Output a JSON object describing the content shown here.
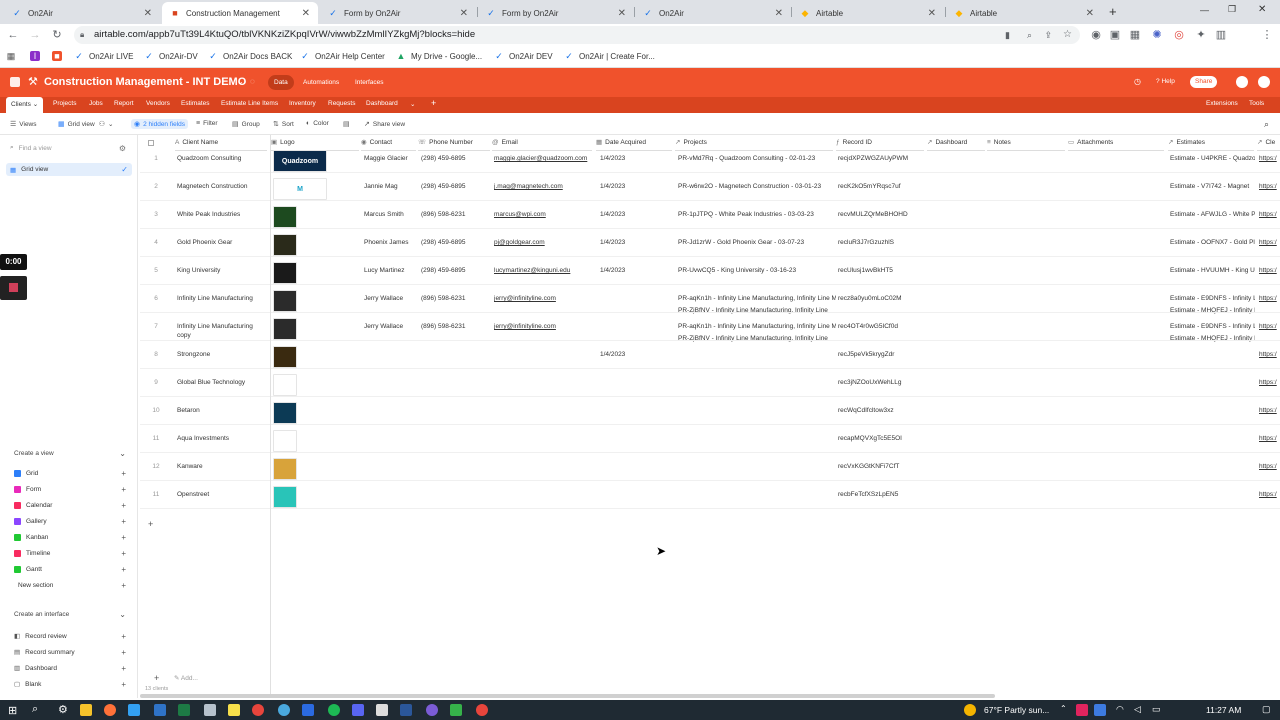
{
  "browser": {
    "tabs": [
      {
        "label": "On2Air",
        "icon": "on2air-icon",
        "active": false
      },
      {
        "label": "Construction Management",
        "icon": "airtable-icon",
        "active": true
      },
      {
        "label": "Form by On2Air",
        "icon": "on2air-icon",
        "active": false
      },
      {
        "label": "Form by On2Air",
        "icon": "on2air-icon",
        "active": false
      },
      {
        "label": "On2Air",
        "icon": "on2air-icon",
        "active": false
      },
      {
        "label": "Airtable",
        "icon": "airtable-icon",
        "active": false
      },
      {
        "label": "Airtable",
        "icon": "airtable-icon",
        "active": false
      }
    ],
    "url": "airtable.com/appb7uTt39L4KtuQO/tblVKNKziZKpqIVrW/viwwbZzMmlIYZkgMj?blocks=hide",
    "bookmarks": [
      "On2Air LIVE",
      "On2Air-DV",
      "On2Air Docs BACK",
      "On2Air Help Center",
      "My Drive - Google...",
      "On2Air DEV",
      "On2Air | Create For..."
    ],
    "profile_initial": "O"
  },
  "app": {
    "base_title": "Construction Management - INT DEMO",
    "nav": [
      "Data",
      "Automations",
      "Interfaces"
    ],
    "help": "Help",
    "share": "Share",
    "brand_color": "#f0522c"
  },
  "tables": [
    "Clients",
    "Projects",
    "Jobs",
    "Report",
    "Vendors",
    "Estimates",
    "Estimate Line Items",
    "Inventory",
    "Requests",
    "Dashboard"
  ],
  "table_right": {
    "extensions": "Extensions",
    "tools": "Tools"
  },
  "viewbar": {
    "views": "Views",
    "grid_view": "Grid view",
    "hidden_fields": "2 hidden fields",
    "filter": "Filter",
    "group": "Group",
    "sort": "Sort",
    "color": "Color",
    "share_view": "Share view"
  },
  "sidebar": {
    "find_placeholder": "Find a view",
    "current_view": "Grid view",
    "create_view": "Create a view",
    "view_types": [
      {
        "label": "Grid",
        "color": "#2d7ff9"
      },
      {
        "label": "Form",
        "color": "#e929ba"
      },
      {
        "label": "Calendar",
        "color": "#f82b60"
      },
      {
        "label": "Gallery",
        "color": "#8b46ff"
      },
      {
        "label": "Kanban",
        "color": "#20c933"
      },
      {
        "label": "Timeline",
        "color": "#f82b60"
      },
      {
        "label": "Gantt",
        "color": "#20c933"
      },
      {
        "label": "New section",
        "color": ""
      }
    ],
    "create_interface": "Create an interface",
    "interface_types": [
      "Record review",
      "Record summary",
      "Dashboard",
      "Blank"
    ]
  },
  "recorder": {
    "timer": "0:00"
  },
  "grid": {
    "columns": [
      "Client Name",
      "Logo",
      "Contact",
      "Phone Number",
      "Email",
      "Date Acquired",
      "Projects",
      "Record ID",
      "Dashboard",
      "Notes",
      "Attachments",
      "Estimates",
      "Cle"
    ],
    "rows": [
      {
        "n": "1",
        "name": "Quadzoom Consulting",
        "name2": "",
        "logo": "#0b2a4a",
        "logo_text": "Quadzoom",
        "contact": "Maggie Glacier",
        "phone": "(298) 459-6895",
        "email": "maggie.glacier@quadzoom.com",
        "date": "1/4/2023",
        "projects": [
          "PR-vMd7Rq - Quadzoom Consulting - 02-01-23"
        ],
        "record": "recjdXPZWGZAUyPWM",
        "estimates": [
          "Estimate - U4PKRE - Quadzo"
        ],
        "cle": "https:/"
      },
      {
        "n": "2",
        "name": "Magnetech Construction",
        "name2": "",
        "logo": "#ffffff",
        "logo_text": "M",
        "contact": "Jannie Mag",
        "phone": "(298) 459-6895",
        "email": "j.mag@magnetech.com",
        "date": "1/4/2023",
        "projects": [
          "PR-w6rw2O - Magnetech Construction - 03-01-23"
        ],
        "record": "recK2kO5mYRqsc7uf",
        "estimates": [
          "Estimate - V7I742 - Magnet"
        ],
        "cle": "https:/"
      },
      {
        "n": "3",
        "name": "White Peak Industries",
        "name2": "",
        "logo": "#1d4a1f",
        "logo_text": "",
        "contact": "Marcus Smith",
        "phone": "(896) 598-6231",
        "email": "marcus@wpi.com",
        "date": "1/4/2023",
        "projects": [
          "PR-1pJTPQ - White Peak Industries - 03-03-23"
        ],
        "record": "recvMULZQrMeBHOHD",
        "estimates": [
          "Estimate - AFWJLG - White P"
        ],
        "cle": "https:/"
      },
      {
        "n": "4",
        "name": "Gold Phoenix Gear",
        "name2": "",
        "logo": "#2a2a1a",
        "logo_text": "",
        "contact": "Phoenix James",
        "phone": "(298) 459-6895",
        "email": "pj@goldgear.com",
        "date": "1/4/2023",
        "projects": [
          "PR-Jd1zrW - Gold Phoenix Gear - 03-07-23"
        ],
        "record": "recluR3J7rGzuzhlS",
        "estimates": [
          "Estimate - OOFNX7 - Gold Pl"
        ],
        "cle": "https:/"
      },
      {
        "n": "5",
        "name": "King University",
        "name2": "",
        "logo": "#1a1a1a",
        "logo_text": "",
        "contact": "Lucy Martinez",
        "phone": "(298) 459-6895",
        "email": "lucymartinez@kinguni.edu",
        "date": "1/4/2023",
        "projects": [
          "PR-UvwCQ5 - King University - 03-16-23"
        ],
        "record": "recUlusj1wvBkHT5",
        "estimates": [
          "Estimate - HVUUMH - King U"
        ],
        "cle": "https:/"
      },
      {
        "n": "6",
        "name": "Infinity Line Manufacturing",
        "name2": "",
        "logo": "#2b2b2b",
        "logo_text": "",
        "contact": "Jerry Wallace",
        "phone": "(896) 598-6231",
        "email": "jerry@infinityline.com",
        "date": "",
        "projects": [
          "PR-aqKn1h - Infinity Line Manufacturing, Infinity Line M",
          "PR-ZjBfNV - Infinity Line Manufacturing, Infinity Line"
        ],
        "record": "recz8a0yu0mLoC02M",
        "estimates": [
          "Estimate - E9DNFS - Infinity L",
          "Estimate - MHQFEJ - Infinity I"
        ],
        "cle": "https:/"
      },
      {
        "n": "7",
        "name": "Infinity Line Manufacturing",
        "name2": "copy",
        "logo": "#2b2b2b",
        "logo_text": "",
        "contact": "Jerry Wallace",
        "phone": "(896) 598-6231",
        "email": "jerry@infinityline.com",
        "date": "",
        "projects": [
          "PR-aqKn1h - Infinity Line Manufacturing, Infinity Line M",
          "PR-ZjBfNV - Infinity Line Manufacturing, Infinity Line"
        ],
        "record": "rec4OT4r0wG5ICf0d",
        "estimates": [
          "Estimate - E9DNFS - Infinity L",
          "Estimate - MHQFEJ - Infinity I"
        ],
        "cle": "https:/"
      },
      {
        "n": "8",
        "name": "Strongzone",
        "name2": "",
        "logo": "#3a2a10",
        "logo_text": "",
        "contact": "",
        "phone": "",
        "email": "",
        "date": "1/4/2023",
        "projects": [],
        "record": "recJ5peVk5krygZdr",
        "estimates": [],
        "cle": "https:/"
      },
      {
        "n": "9",
        "name": "Global Blue Technology",
        "name2": "",
        "logo": "#ffffff",
        "logo_text": "",
        "contact": "",
        "phone": "",
        "email": "",
        "date": "",
        "projects": [],
        "record": "rec3jNZOoUxWehLLg",
        "estimates": [],
        "cle": "https:/"
      },
      {
        "n": "10",
        "name": "Betaron",
        "name2": "",
        "logo": "#0c3a55",
        "logo_text": "",
        "contact": "",
        "phone": "",
        "email": "",
        "date": "",
        "projects": [],
        "record": "recWqCdIfcltow3xz",
        "estimates": [],
        "cle": "https:/"
      },
      {
        "n": "11",
        "name": "Aqua Investments",
        "name2": "",
        "logo": "#ffffff",
        "logo_text": "",
        "contact": "",
        "phone": "",
        "email": "",
        "date": "",
        "projects": [],
        "record": "recapMQVXgTc5E5OI",
        "estimates": [],
        "cle": "https:/"
      },
      {
        "n": "12",
        "name": "Kanware",
        "name2": "",
        "logo": "#d8a33a",
        "logo_text": "",
        "contact": "",
        "phone": "",
        "email": "",
        "date": "",
        "projects": [],
        "record": "recVxKGGtKNFi7CfT",
        "estimates": [],
        "cle": "https:/"
      },
      {
        "n": "11",
        "name": "Openstreet",
        "name2": "",
        "logo": "#29c4b8",
        "logo_text": "",
        "contact": "",
        "phone": "",
        "email": "",
        "date": "",
        "projects": [],
        "record": "recbFeTcfXSzLpEN5",
        "estimates": [],
        "cle": "https:/"
      }
    ],
    "add_label": "Add...",
    "record_count": "13 clients"
  },
  "taskbar": {
    "weather": "67°F  Partly sun...",
    "time": "11:27 AM"
  }
}
